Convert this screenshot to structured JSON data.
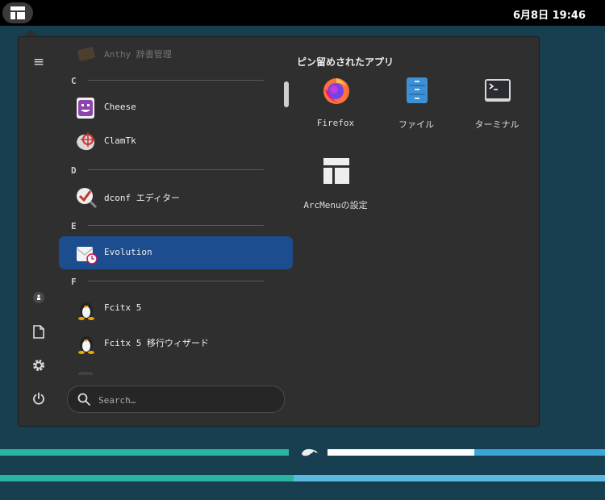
{
  "topbar": {
    "clock": "6月8日  19:46"
  },
  "sidebar": {
    "hamburger": "≡"
  },
  "apps": {
    "faded_top": "Anthy 辞書管理",
    "sections": [
      "C",
      "D",
      "E",
      "F"
    ],
    "items": [
      {
        "label": "Cheese"
      },
      {
        "label": "ClamTk"
      },
      {
        "label": "dconf エディター"
      },
      {
        "label": "Evolution"
      },
      {
        "label": "Fcitx 5"
      },
      {
        "label": "Fcitx 5 移行ウィザード"
      }
    ]
  },
  "search": {
    "placeholder": "Search…"
  },
  "pinned": {
    "title": "ピン留めされたアプリ",
    "items": [
      {
        "label": "Firefox"
      },
      {
        "label": "ファイル"
      },
      {
        "label": "ターミナル"
      },
      {
        "label": "ArcMenuの設定"
      }
    ]
  },
  "colors": {
    "selected": "#1b4d8f",
    "accent_teal": "#2bb5a0",
    "accent_blue": "#3aa6d8"
  }
}
